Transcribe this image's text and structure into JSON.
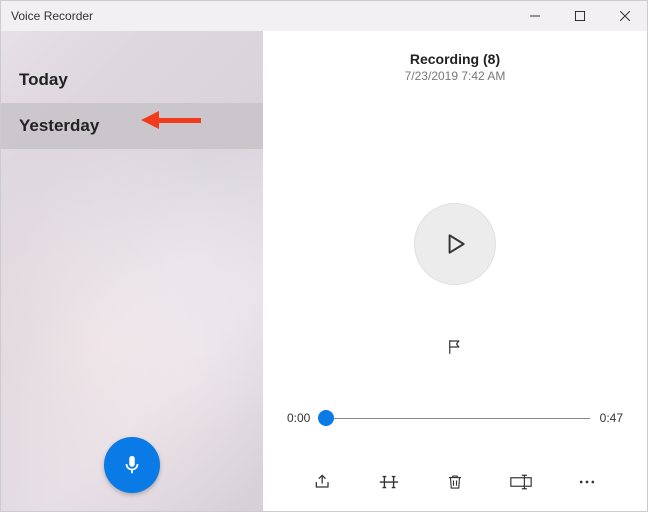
{
  "window": {
    "title": "Voice Recorder"
  },
  "sidebar": {
    "groups": [
      {
        "label": "Today",
        "selected": false
      },
      {
        "label": "Yesterday",
        "selected": true
      }
    ]
  },
  "recording": {
    "title": "Recording (8)",
    "datetime": "7/23/2019 7:42 AM",
    "current_time": "0:00",
    "duration": "0:47"
  },
  "icons": {
    "record": "microphone-icon",
    "play": "play-icon",
    "flag": "flag-icon",
    "share": "share-icon",
    "trim": "trim-icon",
    "delete": "trash-icon",
    "rename": "rename-icon",
    "more": "more-icon"
  }
}
